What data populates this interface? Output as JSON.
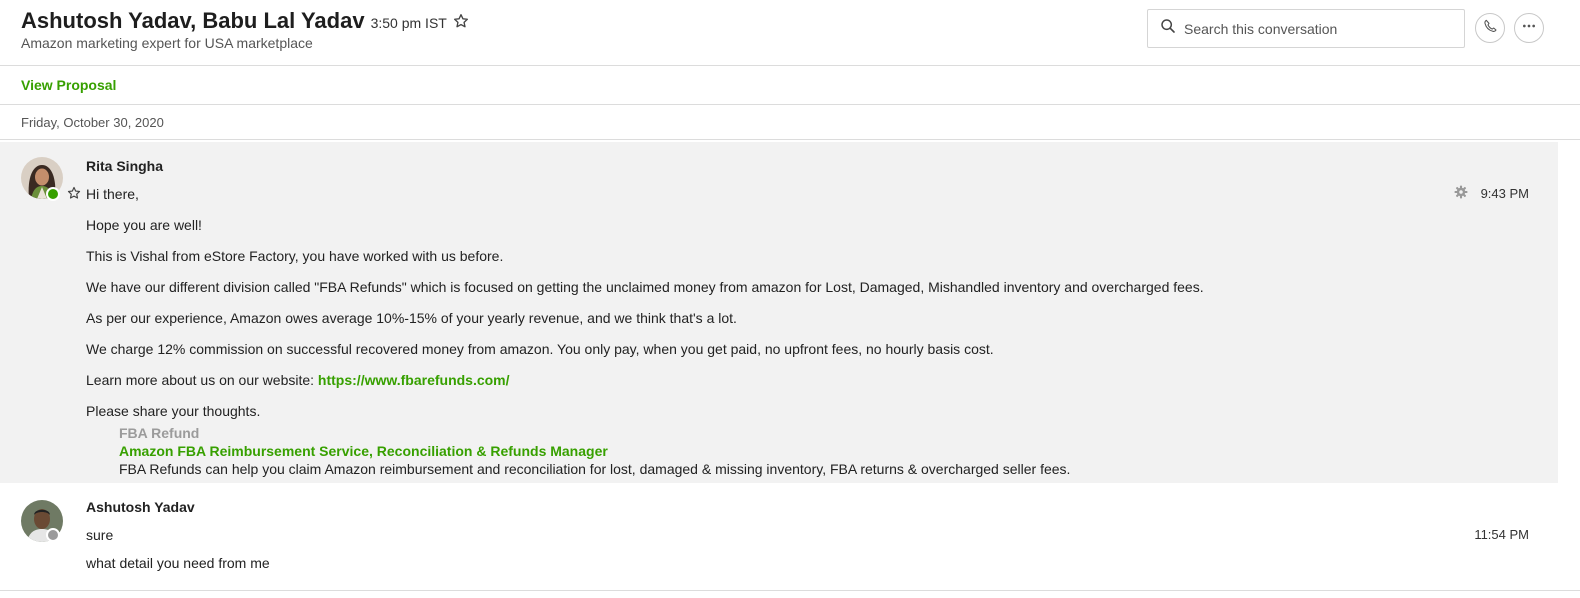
{
  "header": {
    "title": "Ashutosh Yadav, Babu Lal Yadav",
    "local_time": "3:50 pm IST",
    "subtitle": "Amazon marketing expert for USA marketplace",
    "search_placeholder": "Search this conversation"
  },
  "proposal": {
    "link_label": "View Proposal"
  },
  "date_divider": "Friday, October 30, 2020",
  "messages": [
    {
      "sender": "Rita Singha",
      "status": "online",
      "time": "9:43 PM",
      "lines": [
        "Hi there,",
        "Hope you are well!",
        "This is Vishal from eStore Factory, you have worked with us before.",
        "We have our different division called \"FBA Refunds\" which is focused on getting the unclaimed money from amazon for Lost, Damaged, Mishandled inventory and overcharged fees.",
        "As per our experience, Amazon owes average 10%-15% of your yearly revenue, and we think that's a lot.",
        "We charge 12% commission on successful recovered money from amazon. You only pay, when you get paid, no upfront fees, no hourly basis cost.",
        "Learn more about us on our website: ",
        "Please share your thoughts."
      ],
      "url": "https://www.fbarefunds.com/",
      "link_preview": {
        "site": "FBA Refund",
        "title": "Amazon FBA Reimbursement Service, Reconciliation & Refunds Manager",
        "description": "FBA Refunds can help you claim Amazon reimbursement and reconciliation for lost, damaged & missing inventory, FBA returns & overcharged seller fees."
      }
    },
    {
      "sender": "Ashutosh Yadav",
      "status": "offline",
      "time": "11:54 PM",
      "lines": [
        "sure",
        "what detail you need from me"
      ]
    }
  ],
  "colors": {
    "accent_green": "#37a000",
    "highlight_bg": "#f2f2f2",
    "divider": "#dcdcdc"
  },
  "icons": [
    "star-icon",
    "search-icon",
    "phone-icon",
    "more-icon",
    "gear-icon"
  ]
}
